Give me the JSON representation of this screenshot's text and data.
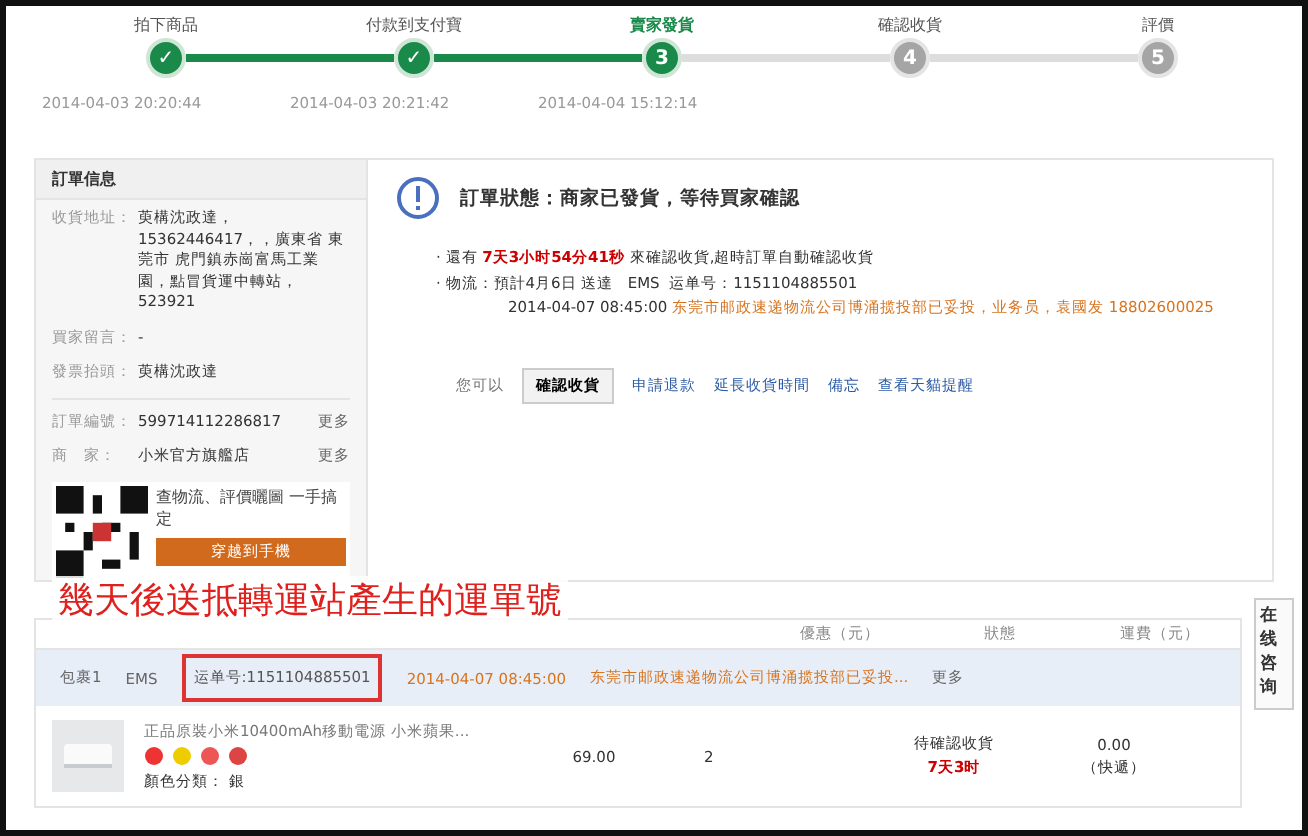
{
  "steps": [
    {
      "label": "拍下商品",
      "mark": "✓",
      "done": true,
      "current": false,
      "time": "2014-04-03 20:20:44"
    },
    {
      "label": "付款到支付寶",
      "mark": "✓",
      "done": true,
      "current": false,
      "time": "2014-04-03 20:21:42"
    },
    {
      "label": "賣家發貨",
      "mark": "3",
      "done": false,
      "current": true,
      "time": "2014-04-04 15:12:14"
    },
    {
      "label": "確認收貨",
      "mark": "4",
      "done": false,
      "current": false
    },
    {
      "label": "評價",
      "mark": "5",
      "done": false,
      "current": false
    }
  ],
  "order_info": {
    "title": "訂單信息",
    "address": {
      "label": "收貨地址：",
      "value": "萸構沈政達，15362446417，，廣東省 東莞市 虎門鎮赤崗富馬工業園，點冒貨運中轉站，523921"
    },
    "buyer_message": {
      "label": "買家留言：",
      "value": "-"
    },
    "invoice_title": {
      "label": "發票抬頭：",
      "value": "萸構沈政達"
    },
    "ids": [
      {
        "label": "訂單編號：",
        "value": "599714112286817",
        "more": "更多"
      },
      {
        "label": "商　家：",
        "value": "小米官方旗艦店",
        "more": "更多"
      }
    ],
    "promo": {
      "text": "查物流、評價曬圖 一手搞定",
      "button": "穿越到手機"
    }
  },
  "status": {
    "title": "訂單狀態：",
    "message": "商家已發貨，等待買家確認",
    "countdown": {
      "prefix": "· 還有",
      "time": "7天3小时54分41秒",
      "suffix": "來確認收貨,超時訂單自動確認收貨"
    },
    "logistics": {
      "label": "· 物流：",
      "eta": "預計4月6日 送達",
      "carrier": "EMS",
      "tracking_label": "运单号：",
      "tracking": "1151104885501",
      "time": "2014-04-07 08:45:00",
      "event": "东莞市邮政速递物流公司博涌揽投部已妥投，业务员，袁國发",
      "phone": "18802600025"
    },
    "actions_label": "您可以",
    "button": "確認收貨",
    "links": [
      "申請退款",
      "延長收貨時間",
      "備忘",
      "查看天貓提醒"
    ]
  },
  "annotation": "幾天後送抵轉運站產生的運單號",
  "table": {
    "columns": [
      "優惠（元）",
      "狀態",
      "運費（元）"
    ],
    "package": {
      "name": "包裹1",
      "carrier": "EMS",
      "tracking": "运单号:1151104885501",
      "time": "2014-04-07 08:45:00",
      "event": "东莞市邮政速递物流公司博涌揽投部已妥投...",
      "more": "更多"
    },
    "item": {
      "title": "正品原裝小米10400mAh移動電源 小米蘋果...",
      "variant_label": "顏色分類：",
      "variant": "銀",
      "price": "69.00",
      "quantity": "2",
      "status": "待確認收貨",
      "countdown": "7天3时",
      "shipping": "0.00",
      "shipping_type": "（快遞）"
    }
  },
  "side_tab": "在线咨询"
}
